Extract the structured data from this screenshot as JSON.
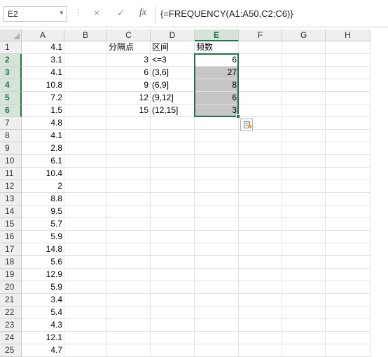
{
  "formula_bar": {
    "name_box": "E2",
    "cancel_icon": "×",
    "confirm_icon": "✓",
    "fx_label": "fx",
    "formula": "{=FREQUENCY(A1:A50,C2:C6)}"
  },
  "columns": [
    "A",
    "B",
    "C",
    "D",
    "E",
    "F",
    "G",
    "H"
  ],
  "rows": [
    {
      "num": "1",
      "A": "4.1",
      "C": "分隔点",
      "D": "区间",
      "E": "频数"
    },
    {
      "num": "2",
      "A": "3.1",
      "C": "3",
      "D": "<=3",
      "E": "6"
    },
    {
      "num": "3",
      "A": "4.1",
      "C": "6",
      "D": "(3,6]",
      "E": "27"
    },
    {
      "num": "4",
      "A": "10.8",
      "C": "9",
      "D": "(6,9]",
      "E": "8"
    },
    {
      "num": "5",
      "A": "7.2",
      "C": "12",
      "D": "(9,12]",
      "E": "6"
    },
    {
      "num": "6",
      "A": "1.5",
      "C": "15",
      "D": "(12,15]",
      "E": "3"
    },
    {
      "num": "7",
      "A": "4.8"
    },
    {
      "num": "8",
      "A": "4.1"
    },
    {
      "num": "9",
      "A": "2.8"
    },
    {
      "num": "10",
      "A": "6.1"
    },
    {
      "num": "11",
      "A": "10.4"
    },
    {
      "num": "12",
      "A": "2"
    },
    {
      "num": "13",
      "A": "8.8"
    },
    {
      "num": "14",
      "A": "9.5"
    },
    {
      "num": "15",
      "A": "5.7"
    },
    {
      "num": "16",
      "A": "5.9"
    },
    {
      "num": "17",
      "A": "14.8"
    },
    {
      "num": "18",
      "A": "5.6"
    },
    {
      "num": "19",
      "A": "12.9"
    },
    {
      "num": "20",
      "A": "5.9"
    },
    {
      "num": "21",
      "A": "3.4"
    },
    {
      "num": "22",
      "A": "5.4"
    },
    {
      "num": "23",
      "A": "4.3"
    },
    {
      "num": "24",
      "A": "12.1"
    },
    {
      "num": "25",
      "A": "4.7"
    }
  ],
  "selection": {
    "column": "E",
    "rows": [
      "2",
      "3",
      "4",
      "5",
      "6"
    ]
  },
  "colors": {
    "accent": "#217346",
    "selected_fill": "#c6c6c6",
    "header_selected": "#d6e3d9"
  },
  "icons": {
    "quick_analysis": "quick-analysis-icon"
  }
}
